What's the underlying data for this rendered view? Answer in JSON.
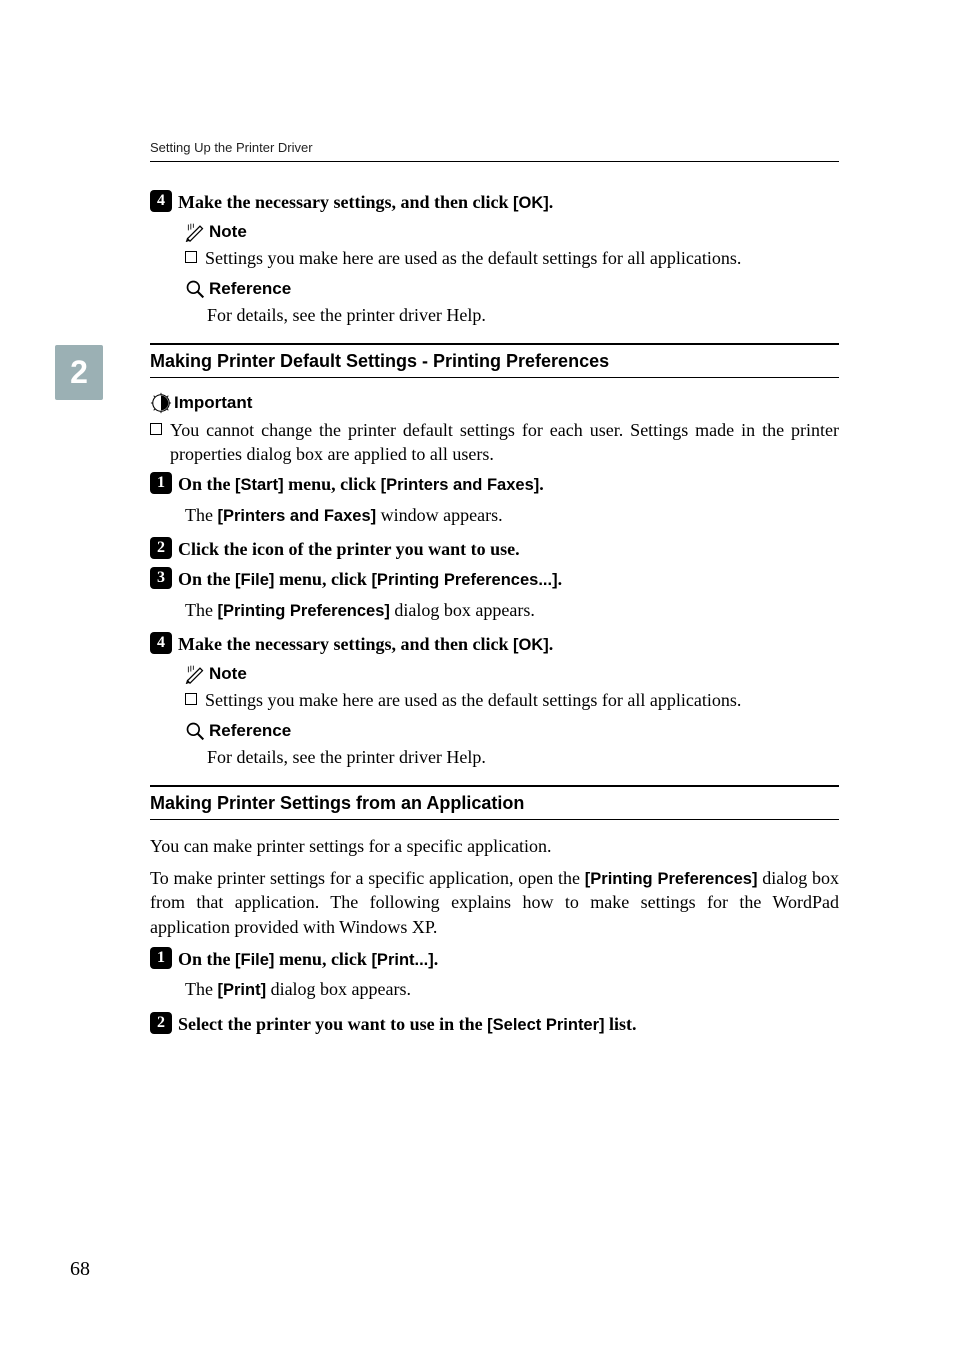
{
  "running_header": "Setting Up the Printer Driver",
  "tab": "2",
  "step4a": {
    "num": "4",
    "pre": "Make the necessary settings, and then click ",
    "ui": "[OK]",
    "post": "."
  },
  "note_label": "Note",
  "note1_text": "Settings you make here are used as the default settings for all applications.",
  "ref_label": "Reference",
  "ref1_text": "For details, see the printer driver Help.",
  "section1": "Making Printer Default Settings - Printing Preferences",
  "imp_label": "Important",
  "imp_text": "You cannot change the printer default settings for each user. Settings made in the printer properties dialog box are applied to all users.",
  "s1_step1": {
    "num": "1",
    "pre": "On the ",
    "ui1": "[Start]",
    "mid": " menu, click ",
    "ui2": "[Printers and Faxes]",
    "post": "."
  },
  "s1_step1_cont": {
    "pre": "The ",
    "ui": "[Printers and Faxes]",
    "post": " window appears."
  },
  "s1_step2": {
    "num": "2",
    "text": "Click the icon of the printer you want to use."
  },
  "s1_step3": {
    "num": "3",
    "pre": "On the ",
    "ui1": "[File]",
    "mid": " menu, click ",
    "ui2": "[Printing Preferences...]",
    "post": "."
  },
  "s1_step3_cont": {
    "pre": "The ",
    "ui": "[Printing Preferences]",
    "post": " dialog box appears."
  },
  "s1_step4": {
    "num": "4",
    "pre": "Make the necessary settings, and then click ",
    "ui": "[OK]",
    "post": "."
  },
  "note2_text": "Settings you make here are used as the default settings for all applications.",
  "ref2_text": "For details, see the printer driver Help.",
  "section2": "Making Printer Settings from an Application",
  "s2_intro1": "You can make printer settings for a specific application.",
  "s2_intro2_pre": "To make printer settings for a specific application, open the ",
  "s2_intro2_ui": "[Printing Preferences]",
  "s2_intro2_post": " dialog box from that application. The following explains how to make settings for the WordPad application provided with Windows XP.",
  "s2_step1": {
    "num": "1",
    "pre": "On the ",
    "ui1": "[File]",
    "mid": " menu, click ",
    "ui2": "[Print...]",
    "post": "."
  },
  "s2_step1_cont": {
    "pre": "The ",
    "ui": "[Print]",
    "post": " dialog box appears."
  },
  "s2_step2": {
    "num": "2",
    "pre": "Select the printer you want to use in the ",
    "ui": "[Select Printer]",
    "post": " list."
  },
  "page_number": "68"
}
